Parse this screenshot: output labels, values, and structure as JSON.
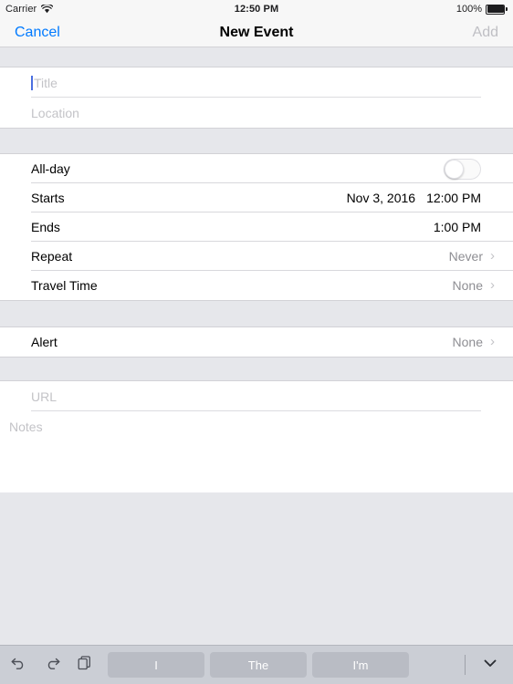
{
  "status_bar": {
    "carrier": "Carrier",
    "wifi_icon": "wifi-icon",
    "time": "12:50 PM",
    "battery_percent": "100%",
    "battery_icon": "battery-full-icon"
  },
  "nav_bar": {
    "cancel_label": "Cancel",
    "title": "New Event",
    "add_label": "Add"
  },
  "form": {
    "title_field": {
      "label": "title-field",
      "value": "",
      "placeholder": "Title"
    },
    "location_field": {
      "value": "",
      "placeholder": "Location"
    },
    "all_day": {
      "label": "All-day",
      "value": "off"
    },
    "starts": {
      "label": "Starts",
      "date": "Nov 3, 2016",
      "time": "12:00 PM"
    },
    "ends": {
      "label": "Ends",
      "date": "",
      "time": "1:00 PM"
    },
    "repeat": {
      "label": "Repeat",
      "value": "Never",
      "chevron": "›"
    },
    "travel_time": {
      "label": "Travel Time",
      "value": "None",
      "chevron": "›"
    },
    "alert": {
      "label": "Alert",
      "value": "None",
      "chevron": "›"
    },
    "url_field": {
      "value": "",
      "placeholder": "URL"
    },
    "notes_field": {
      "value": "",
      "placeholder": "Notes"
    }
  },
  "keyboard_toolbar": {
    "undo_icon": "undo-icon",
    "redo_icon": "redo-icon",
    "paste_icon": "paste-icon",
    "suggestions": [
      {
        "label": "I"
      },
      {
        "label": "The"
      },
      {
        "label": "I'm"
      }
    ],
    "dismiss_icon": "chevron-down-icon"
  },
  "colors": {
    "accent_blue": "#007aff",
    "background_gray": "#e6e7eb",
    "card_white": "#ffffff",
    "placeholder_gray": "#c3c3c7",
    "value_gray": "#8e8e93",
    "toolbar_gray": "#cbced5"
  }
}
